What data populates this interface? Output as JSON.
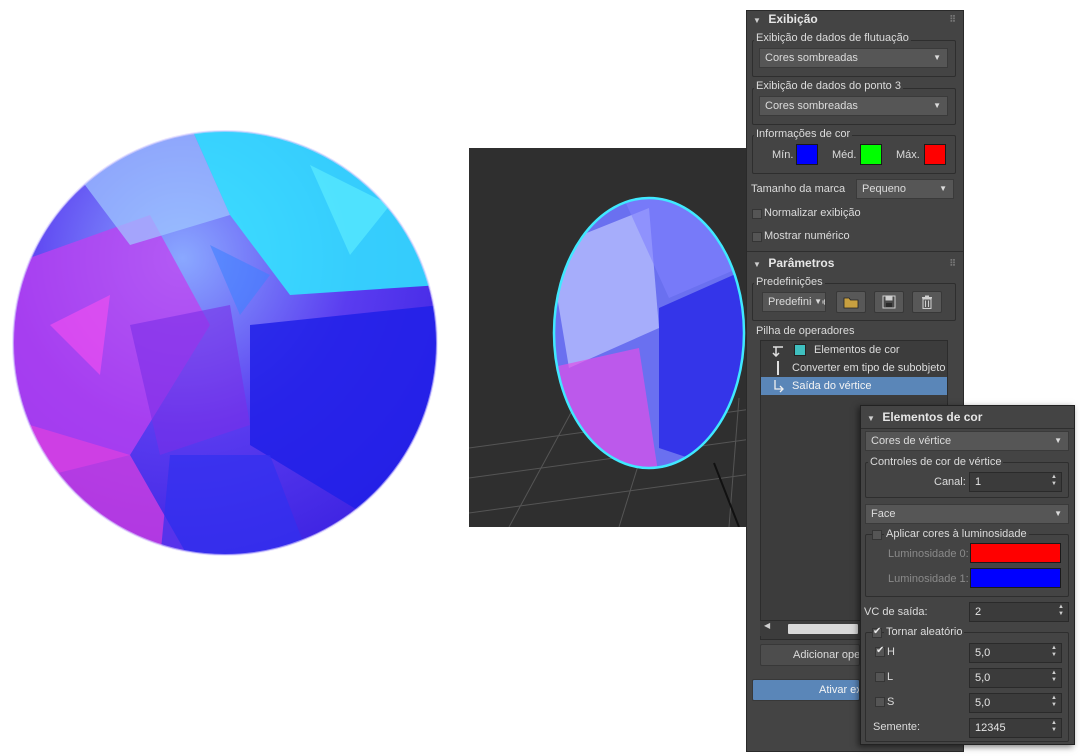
{
  "exibicao": {
    "title": "Exibição",
    "float_group_label": "Exibição de dados de flutuação",
    "float_dropdown": "Cores sombreadas",
    "point3_group_label": "Exibição de dados do ponto 3",
    "point3_dropdown": "Cores sombreadas",
    "color_info_label": "Informações de cor",
    "min_label": "Mín.",
    "med_label": "Méd.",
    "max_label": "Máx.",
    "colors": {
      "min": "#0000ff",
      "med": "#00ff00",
      "max": "#ff0000"
    },
    "marker_size_label": "Tamanho da marca",
    "marker_size_value": "Pequeno",
    "normalize_label": "Normalizar exibição",
    "normalize_checked": false,
    "numeric_label": "Mostrar numérico",
    "numeric_checked": false
  },
  "parametros": {
    "title": "Parâmetros",
    "presets_label": "Predefinições",
    "presets_dropdown": "Predefinições",
    "stack_label": "Pilha de operadores",
    "stack_items": [
      {
        "label": "Elementos de cor",
        "selected": false
      },
      {
        "label": "Converter em tipo de subobjeto",
        "selected": false
      },
      {
        "label": "Saída do vértice",
        "selected": true
      }
    ],
    "add_operator_button": "Adicionar operador",
    "activate_button": "Ativar exibição"
  },
  "elementos_de_cor": {
    "title": "Elementos de cor",
    "mode_dropdown": "Cores de vértice",
    "vertex_controls_label": "Controles de cor de vértice",
    "channel_label": "Canal:",
    "channel_value": "1",
    "face_dropdown": "Face",
    "apply_luminosity_label": "Aplicar cores à luminosidade",
    "apply_luminosity_checked": false,
    "luminosity0_label": "Luminosidade 0:",
    "luminosity0_color": "#ff0000",
    "luminosity1_label": "Luminosidade 1:",
    "luminosity1_color": "#0000ff",
    "output_vc_label": "VC de saída:",
    "output_vc_value": "2",
    "randomize_label": "Tornar aleatório",
    "randomize_checked": true,
    "h_label": "H",
    "h_checked": true,
    "h_value": "5,0",
    "l_label": "L",
    "l_checked": false,
    "l_value": "5,0",
    "s_label": "S",
    "s_checked": false,
    "s_value": "5,0",
    "seed_label": "Semente:",
    "seed_value": "12345"
  }
}
